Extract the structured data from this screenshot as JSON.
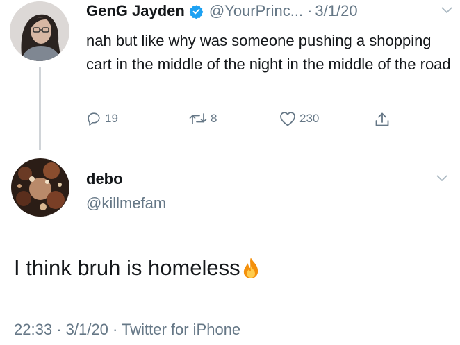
{
  "parent_tweet": {
    "display_name": "GenG Jayden",
    "handle": "@YourPrinc...",
    "date": "3/1/20",
    "separator": "·",
    "text": "nah but like why was someone pushing a shopping cart in the middle of the night in the middle of the road",
    "counts": {
      "replies": "19",
      "retweets": "8",
      "likes": "230"
    }
  },
  "reply_tweet": {
    "display_name": "debo",
    "handle": "@killmefam",
    "text": "I think bruh is homeless",
    "time": "22:33",
    "date": "3/1/20",
    "separator": "·",
    "source": "Twitter for iPhone"
  },
  "icons": {
    "verified": "verified-badge-icon",
    "chevron": "chevron-down-icon",
    "reply": "reply-icon",
    "retweet": "retweet-icon",
    "like": "heart-icon",
    "share": "share-icon",
    "emoji": "fire-emoji"
  },
  "colors": {
    "text": "#14171a",
    "secondary": "#657786",
    "verified": "#1da1f2"
  }
}
